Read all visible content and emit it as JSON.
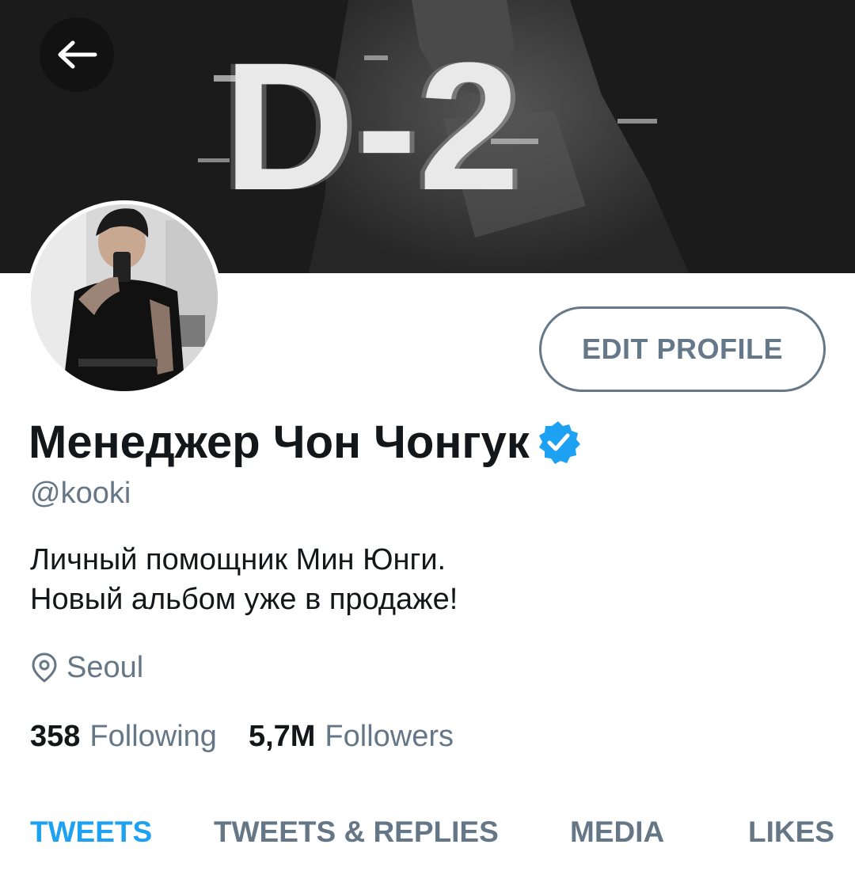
{
  "banner": {
    "text": "D-2"
  },
  "profile": {
    "display_name": "Менеджер Чон Чонгук",
    "handle": "@kooki",
    "bio_lines": [
      "Личный помощник Мин Юнги.",
      "Новый альбом уже в продаже!"
    ],
    "location": "Seoul",
    "verified": true
  },
  "actions": {
    "edit_profile": "EDIT PROFILE"
  },
  "stats": {
    "following_count": "358",
    "following_label": "Following",
    "followers_count": "5,7M",
    "followers_label": "Followers"
  },
  "tabs": [
    {
      "label": "TWEETS",
      "active": true
    },
    {
      "label": "TWEETS & REPLIES",
      "active": false
    },
    {
      "label": "MEDIA",
      "active": false
    },
    {
      "label": "LIKES",
      "active": false
    }
  ],
  "colors": {
    "accent": "#1da1f2",
    "muted": "#657786",
    "text": "#14171a",
    "banner": "#1b1b1b"
  },
  "icons": [
    "back-arrow-icon",
    "verified-badge-icon",
    "location-pin-icon"
  ]
}
